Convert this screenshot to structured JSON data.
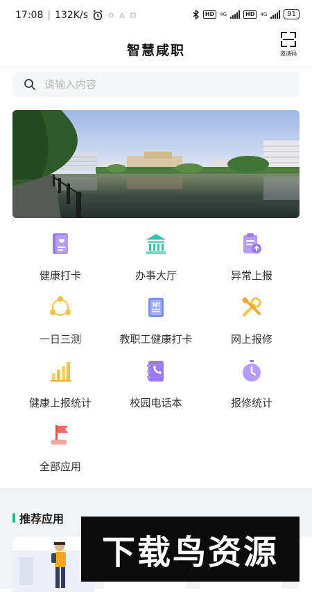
{
  "status_bar": {
    "time": "17:08",
    "speed": "132K/s",
    "hd1": "HD",
    "net1": "4G",
    "hd2": "HD",
    "net2": "4G",
    "battery": "91"
  },
  "header": {
    "title": "智慧咸职",
    "invite_label": "邀请码"
  },
  "search": {
    "placeholder": "请输入内容"
  },
  "apps": [
    {
      "label": "健康打卡",
      "icon": "health-card-icon"
    },
    {
      "label": "办事大厅",
      "icon": "service-hall-icon"
    },
    {
      "label": "异常上报",
      "icon": "abnormal-report-icon"
    },
    {
      "label": "一日三测",
      "icon": "three-tests-icon"
    },
    {
      "label": "教职工健康打卡",
      "icon": "staff-health-card-icon"
    },
    {
      "label": "网上报修",
      "icon": "online-repair-icon"
    },
    {
      "label": "健康上报统计",
      "icon": "health-stats-icon"
    },
    {
      "label": "校园电话本",
      "icon": "phonebook-icon"
    },
    {
      "label": "报修统计",
      "icon": "repair-stats-icon"
    },
    {
      "label": "全部应用",
      "icon": "all-apps-icon"
    }
  ],
  "recommended": {
    "title": "推荐应用"
  },
  "watermark": "下载鸟资源",
  "colors": {
    "accent_green": "#1db985",
    "purple": "#9b7bf0",
    "teal": "#2ec4a6",
    "gold": "#f5c242",
    "coral": "#f06a5e"
  }
}
